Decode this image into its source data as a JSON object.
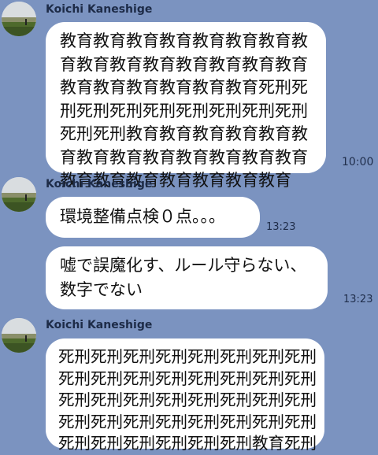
{
  "colors": {
    "background": "#7b93c0",
    "bubble": "#ffffff",
    "sender_text": "#1d2b47",
    "time_text": "#1f2d4a"
  },
  "messages": [
    {
      "sender": "Koichi Kaneshige",
      "avatar": "field-photo-avatar",
      "text": "教育教育教育教育教育教育教育教育教育教育教育教育教育教育教育教育教育教育教育教育教育死刑死刑死刑死刑死刑死刑死刑死刑死刑死刑死刑教育教育教育教育教育教育教育教育教育教育教育教育教育教育教育教育教育教育教育教育",
      "time": "10:00"
    },
    {
      "sender": "Koichi Kaneshige",
      "avatar": "field-photo-avatar",
      "text": "環境整備点検０点。。。",
      "time": "13:23"
    },
    {
      "text": "嘘で誤魔化す、ルール守らない、\n数字でない",
      "time": "13:23"
    },
    {
      "sender": "Koichi Kaneshige",
      "avatar": "field-photo-avatar",
      "text": "死刑死刑死刑死刑死刑死刑死刑死刑死刑死刑死刑死刑死刑死刑死刑死刑死刑死刑死刑死刑死刑死刑死刑死刑死刑死刑死刑死刑死刑死刑死刑死刑死刑死刑死刑死刑死刑死刑教育死刑"
    }
  ]
}
